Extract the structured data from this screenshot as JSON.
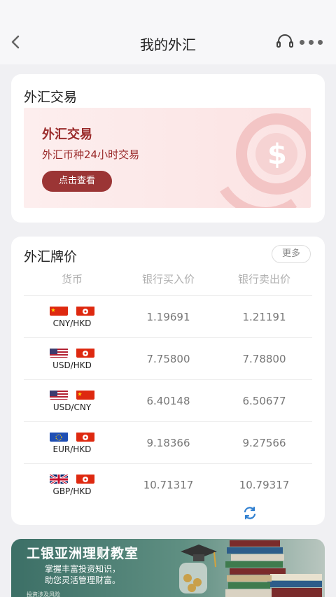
{
  "header": {
    "title": "我的外汇"
  },
  "trade_card": {
    "title": "外汇交易",
    "promo": {
      "title": "外汇交易",
      "subtitle": "外汇币种24小时交易",
      "button": "点击查看"
    }
  },
  "rates_card": {
    "title": "外汇牌价",
    "more_label": "更多",
    "columns": [
      "货币",
      "银行买入价",
      "银行卖出价"
    ],
    "rows": [
      {
        "pair": "CNY/HKD",
        "flags": [
          "cn-flag",
          "hk-flag"
        ],
        "buy": "1.19691",
        "sell": "1.21191"
      },
      {
        "pair": "USD/HKD",
        "flags": [
          "us-flag",
          "hk-flag"
        ],
        "buy": "7.75800",
        "sell": "7.78800"
      },
      {
        "pair": "USD/CNY",
        "flags": [
          "us-flag",
          "cn-flag"
        ],
        "buy": "6.40148",
        "sell": "6.50677"
      },
      {
        "pair": "EUR/HKD",
        "flags": [
          "eu-flag",
          "hk-flag"
        ],
        "buy": "9.18366",
        "sell": "9.27566"
      },
      {
        "pair": "GBP/HKD",
        "flags": [
          "uk-flag",
          "hk-flag"
        ],
        "buy": "10.71317",
        "sell": "10.79317"
      }
    ]
  },
  "banner": {
    "title": "工银亚洲理财教室",
    "line1": "掌握丰富投资知识，",
    "line2": "助您灵活管理财富。",
    "footnote": "投资涉及风险"
  },
  "colors": {
    "accent": "#9b3535",
    "promo_bg": "#fdeeee",
    "refresh": "#2f7fd0"
  }
}
